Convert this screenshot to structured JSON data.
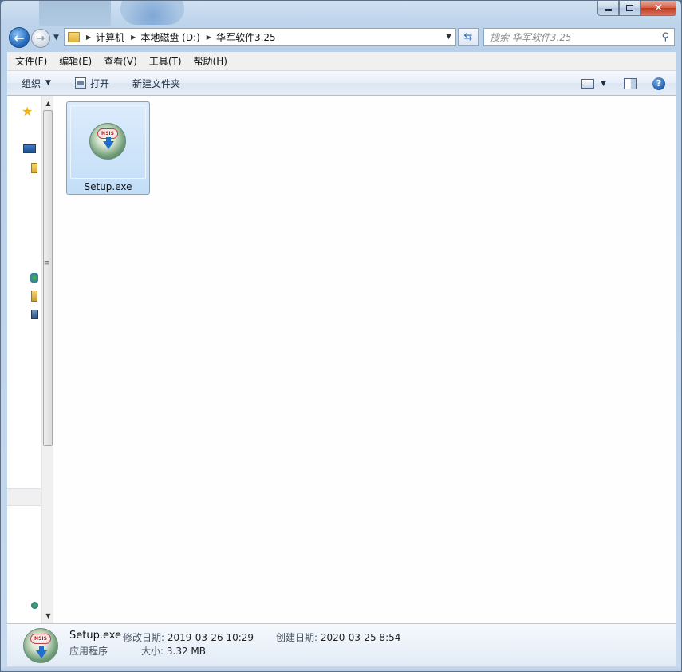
{
  "window": {
    "caption_buttons": {
      "minimize": "minimize",
      "maximize": "maximize",
      "close": "✕"
    }
  },
  "nav": {
    "back_icon": "arrow-left-icon",
    "forward_icon": "arrow-right-icon",
    "breadcrumb": [
      "计算机",
      "本地磁盘 (D:)",
      "华军软件3.25"
    ],
    "search_placeholder": "搜索 华军软件3.25"
  },
  "menubar": {
    "items": [
      "文件(F)",
      "编辑(E)",
      "查看(V)",
      "工具(T)",
      "帮助(H)"
    ]
  },
  "toolbar": {
    "organize_label": "组织",
    "open_label": "打开",
    "new_folder_label": "新建文件夹"
  },
  "files": [
    {
      "name": "Setup.exe",
      "icon": "nsis-installer-icon",
      "badge": "NSIS"
    }
  ],
  "details": {
    "name": "Setup.exe",
    "type": "应用程序",
    "modified_label": "修改日期:",
    "modified_value": "2019-03-26 10:29",
    "size_label": "大小:",
    "size_value": "3.32 MB",
    "created_label": "创建日期:",
    "created_value": "2020-03-25 8:54"
  },
  "colors": {
    "selection": "#cce4fa",
    "selection_border": "#7da2ce",
    "close_button": "#c0391f",
    "frame": "#b9d1ea"
  }
}
